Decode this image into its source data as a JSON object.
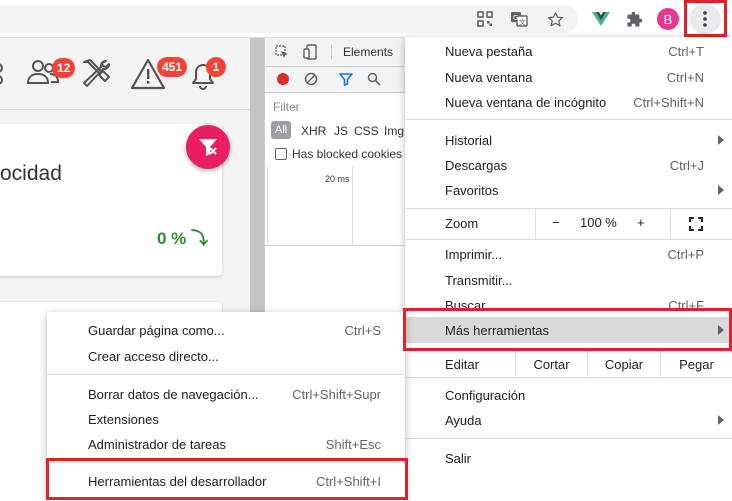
{
  "toolbar": {
    "icons": [
      "qr-code-icon",
      "translate-icon",
      "star-icon",
      "vue-devtools-icon",
      "extensions-icon"
    ],
    "avatar_letter": "B",
    "menu_button": "chrome-menu-icon"
  },
  "page": {
    "badges": {
      "users": "12",
      "alerts": "451",
      "notifications": "1"
    },
    "card_title": "ocidad",
    "card_value": "0 % ⤵"
  },
  "devtools": {
    "tab": "Elements",
    "filter_placeholder": "Filter",
    "types": [
      "All",
      "XHR",
      "JS",
      "CSS",
      "Img"
    ],
    "hide_blocked": "Has blocked cookies",
    "timeline_label": "20 ms"
  },
  "menu": {
    "new_tab": {
      "label": "Nueva pestaña",
      "shortcut": "Ctrl+T"
    },
    "new_window": {
      "label": "Nueva ventana",
      "shortcut": "Ctrl+N"
    },
    "incognito": {
      "label": "Nueva ventana de incógnito",
      "shortcut": "Ctrl+Shift+N"
    },
    "history": {
      "label": "Historial"
    },
    "downloads": {
      "label": "Descargas",
      "shortcut": "Ctrl+J"
    },
    "bookmarks": {
      "label": "Favoritos"
    },
    "zoom": {
      "label": "Zoom",
      "minus": "−",
      "value": "100 %",
      "plus": "+"
    },
    "print": {
      "label": "Imprimir...",
      "shortcut": "Ctrl+P"
    },
    "cast": {
      "label": "Transmitir..."
    },
    "find": {
      "label": "Buscar",
      "shortcut": "Ctrl+F"
    },
    "more_tools": {
      "label": "Más herramientas"
    },
    "edit": {
      "label": "Editar",
      "cut": "Cortar",
      "copy": "Copiar",
      "paste": "Pegar"
    },
    "settings": {
      "label": "Configuración"
    },
    "help": {
      "label": "Ayuda"
    },
    "exit": {
      "label": "Salir"
    }
  },
  "submenu": {
    "save_page": {
      "label": "Guardar página como...",
      "shortcut": "Ctrl+S"
    },
    "create_shortcut": {
      "label": "Crear acceso directo..."
    },
    "clear_data": {
      "label": "Borrar datos de navegación...",
      "shortcut": "Ctrl+Shift+Supr"
    },
    "extensions": {
      "label": "Extensiones"
    },
    "task_manager": {
      "label": "Administrador de tareas",
      "shortcut": "Shift+Esc"
    },
    "dev_tools": {
      "label": "Herramientas del desarrollador",
      "shortcut": "Ctrl+Shift+I"
    }
  },
  "colors": {
    "highlight": "#e0202a",
    "fab": "#e91e63",
    "badge": "#f44336",
    "avatar": "#e8378f"
  }
}
